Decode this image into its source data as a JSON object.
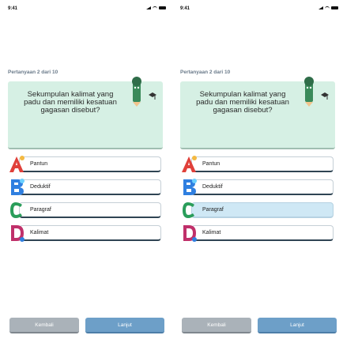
{
  "status_bar": {
    "time": "9:41"
  },
  "question": {
    "counter": "Pertanyaan 2 dari 10",
    "text": "Sekumpulan kalimat yang padu dan memiliki kesatuan gagasan disebut?"
  },
  "options": [
    {
      "letter": "A",
      "label": "Pantun",
      "color": "#e0403a"
    },
    {
      "letter": "B",
      "label": "Deduktif",
      "color": "#2f7fe0"
    },
    {
      "letter": "C",
      "label": "Paragraf",
      "color": "#2a9d5a"
    },
    {
      "letter": "D",
      "label": "Kalimat",
      "color": "#c0306a"
    }
  ],
  "screens": [
    {
      "selected_option": null
    },
    {
      "selected_option": "C"
    }
  ],
  "buttons": {
    "back_label": "Kembali",
    "next_label": "Lanjut"
  },
  "colors": {
    "question_card": "#d6f0e4",
    "selected_option": "#cfe8f5",
    "back_button": "#aab2b9",
    "next_button": "#6d9fc8"
  }
}
